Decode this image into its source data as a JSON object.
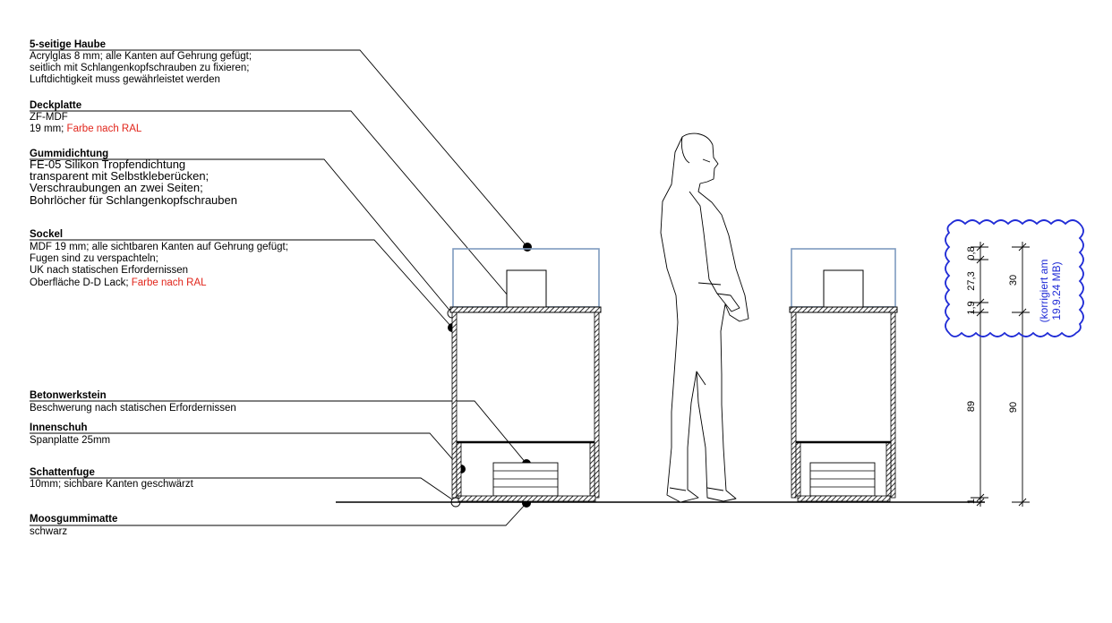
{
  "labels": [
    {
      "key": "haube",
      "title": "5-seitige Haube",
      "lines": [
        {
          "text": "Acrylglas 8 mm; alle Kanten auf Gehrung gefügt;"
        },
        {
          "text": "seitlich mit Schlangenkopfschrauben zu fixieren;"
        },
        {
          "text": "Luftdichtigkeit muss gewährleistet werden"
        }
      ]
    },
    {
      "key": "deckplatte",
      "title": "Deckplatte",
      "lines": [
        {
          "text": "ZF-MDF"
        },
        {
          "text": "19 mm; ",
          "red": "Farbe nach RAL"
        }
      ]
    },
    {
      "key": "gummidichtung",
      "title": "Gummidichtung",
      "lines": [
        {
          "text": "FE-05 Silikon Tropfendichtung"
        },
        {
          "text": "transparent mit Selbstkleberücken;"
        },
        {
          "text": "Verschraubungen an zwei Seiten;"
        },
        {
          "text": "Bohrlöcher für Schlangenkopfschrauben"
        }
      ]
    },
    {
      "key": "sockel",
      "title": "Sockel",
      "lines": [
        {
          "text": "MDF 19 mm; alle sichtbaren Kanten auf Gehrung gefügt;"
        },
        {
          "text": "Fugen sind zu verspachteln;"
        },
        {
          "text": "UK nach statischen Erfordernissen"
        },
        {
          "text": "Oberfläche D-D Lack; ",
          "red": "Farbe nach RAL"
        }
      ]
    },
    {
      "key": "betonwerkstein",
      "title": "Betonwerkstein",
      "lines": [
        {
          "text": "Beschwerung nach statischen Erfordernissen"
        }
      ]
    },
    {
      "key": "innenschuh",
      "title": "Innenschuh",
      "lines": [
        {
          "text": "Spanplatte 25mm"
        }
      ]
    },
    {
      "key": "schattenfuge",
      "title": "Schattenfuge",
      "lines": [
        {
          "text": "10mm; sichbare Kanten geschwärzt"
        }
      ]
    },
    {
      "key": "moosgummimatte",
      "title": "Moosgummimatte",
      "lines": [
        {
          "text": "schwarz"
        }
      ]
    }
  ],
  "dimensions": {
    "inner": [
      "0,8",
      "27,3",
      "1,9",
      "89",
      "1"
    ],
    "outer": [
      "30",
      "90"
    ]
  },
  "revision_note": [
    "(korrigiert am",
    "19.9.24 MB)"
  ],
  "colors": {
    "red_text": "#e1251b",
    "note_blue": "#1f2bd6",
    "acrylic_outline": "#7f9bbf",
    "hatch": "#000000"
  }
}
